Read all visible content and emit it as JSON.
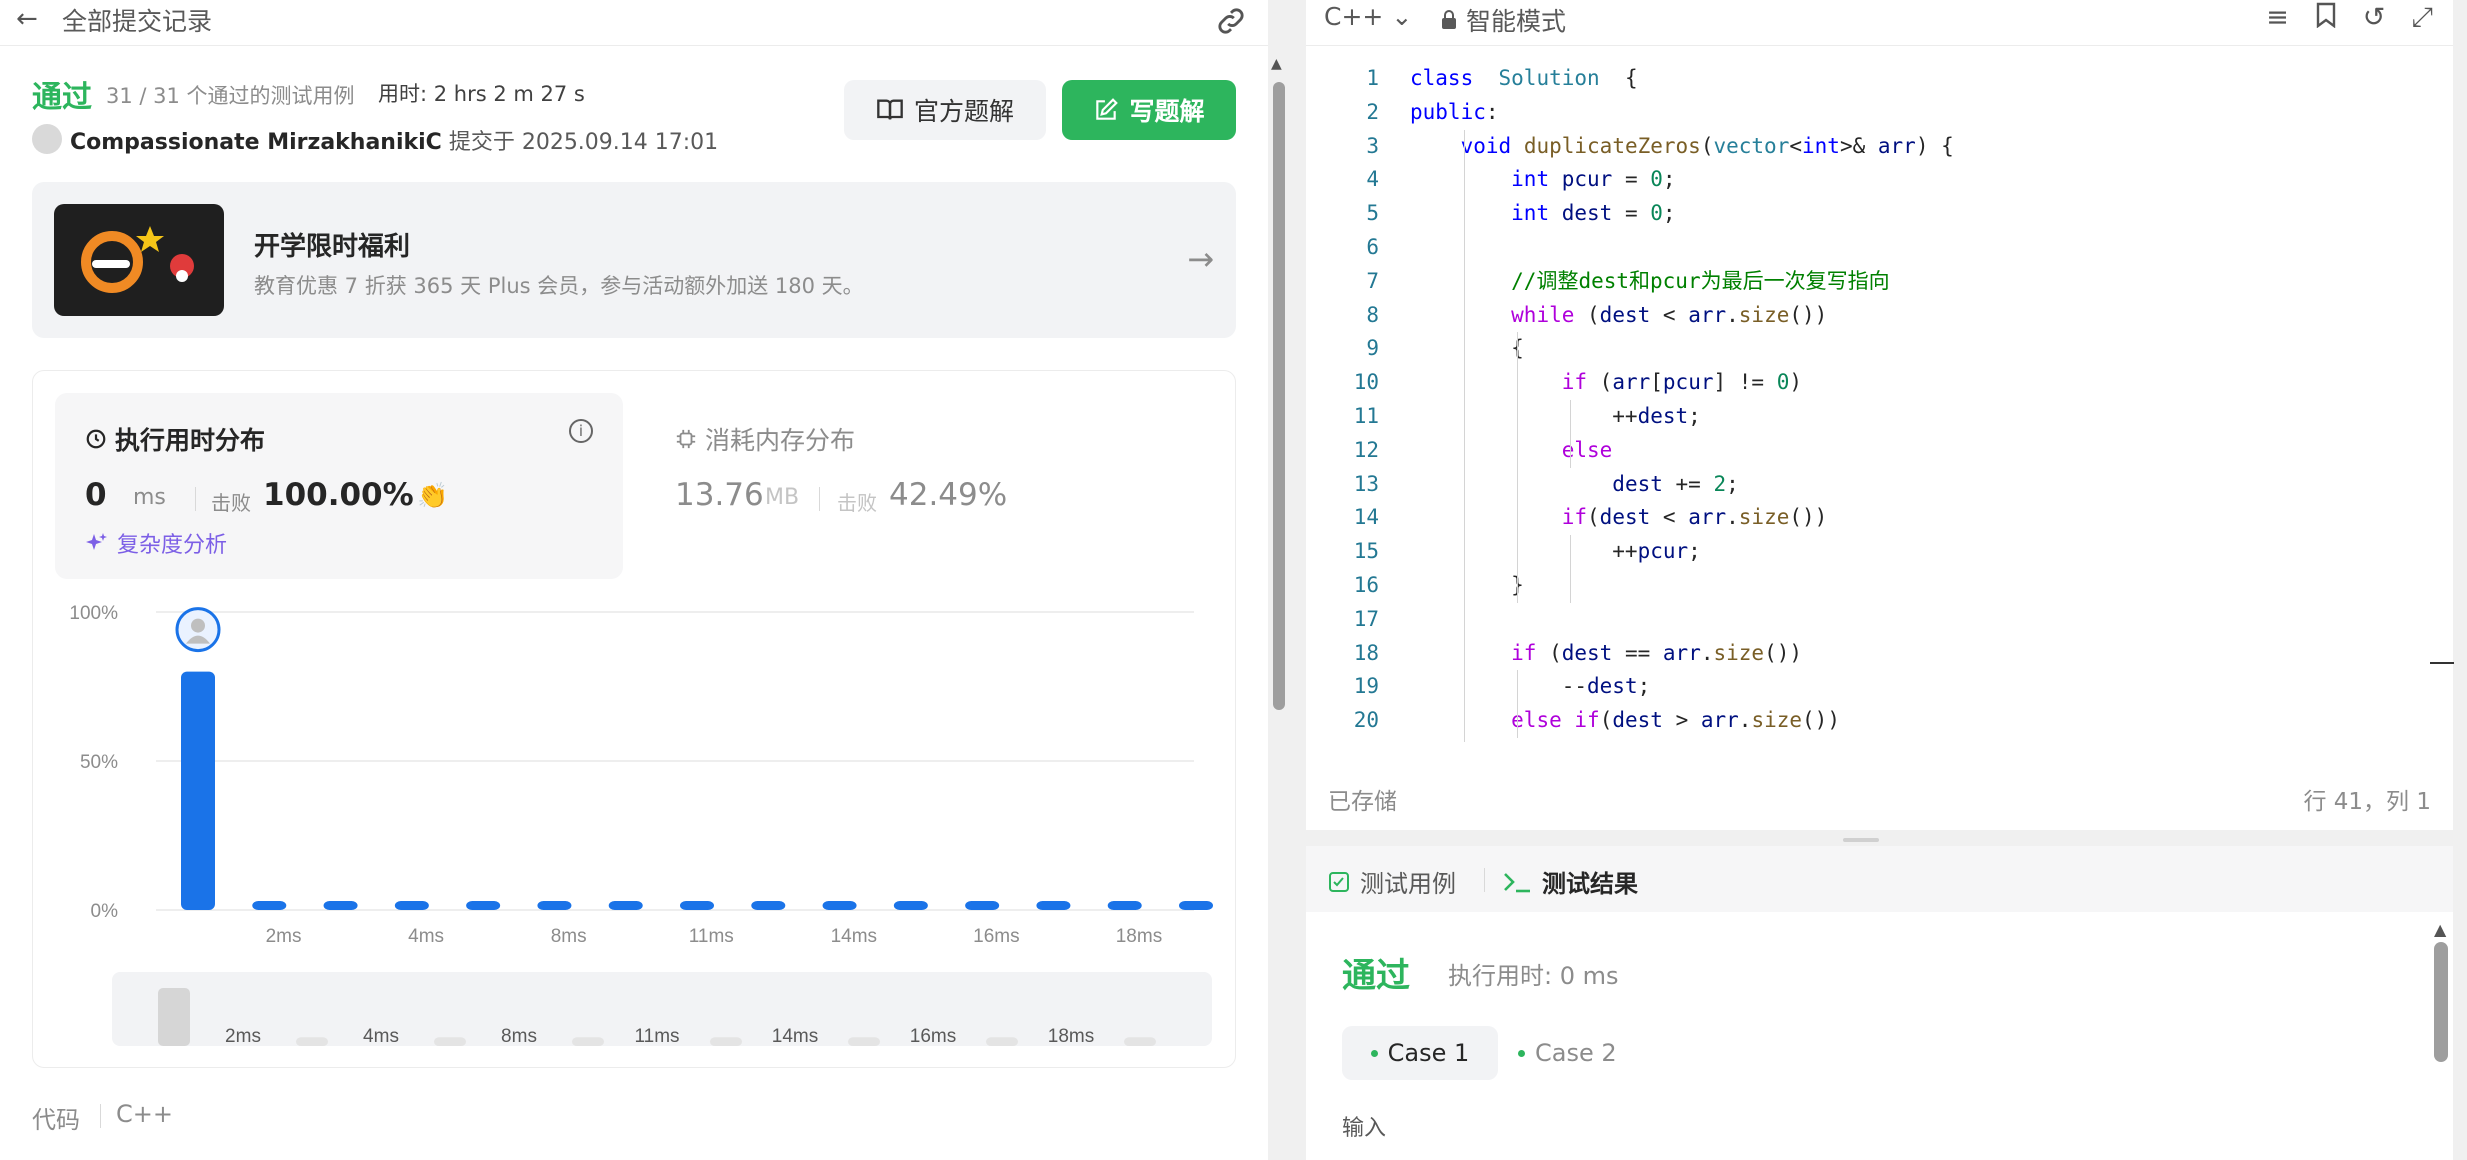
{
  "left": {
    "title": "全部提交记录",
    "status": "通过",
    "cases_passed": "31 / 31 个通过的测试用例",
    "elapsed": "用时: 2 hrs 2 m 27 s",
    "user": "Compassionate MirzakhanikiC",
    "submitted": "提交于 2025.09.14 17:01",
    "btn_official": "官方题解",
    "btn_write": "写题解",
    "promo_title": "开学限时福利",
    "promo_sub": "教育优惠 7 折获 365 天 Plus 会员，参与活动额外加送 180 天。",
    "runtime_head": "执行用时分布",
    "runtime_val": "0",
    "runtime_unit": "ms",
    "beat": "击败",
    "runtime_pct": "100.00%",
    "complexity": "复杂度分析",
    "mem_head": "消耗内存分布",
    "mem_val": "13.76",
    "mem_unit": "MB",
    "mem_pct": "42.49%",
    "code_label": "代码",
    "code_lang": "C++"
  },
  "chart_data": {
    "type": "bar",
    "ytick_labels": [
      "100%",
      "50%",
      "0%"
    ],
    "xtick_labels": [
      "2ms",
      "4ms",
      "8ms",
      "11ms",
      "14ms",
      "16ms",
      "18ms"
    ],
    "values": [
      80,
      3,
      3,
      3,
      3,
      3,
      3,
      3,
      3,
      3,
      3,
      3,
      3,
      3,
      3
    ],
    "ylim": [
      0,
      100
    ],
    "highlight_index": 0,
    "bar_color": "#1a73e8",
    "minimap_values": [
      20,
      3,
      3,
      3,
      3,
      3,
      3,
      3,
      3
    ]
  },
  "editor": {
    "lang": "C++",
    "mode": "智能模式",
    "saved": "已存储",
    "position": "行 41，列 1",
    "lines": [
      [
        [
          "k",
          "class"
        ],
        [
          "",
          "  "
        ],
        [
          "c",
          "Solution"
        ],
        [
          "",
          "  {"
        ]
      ],
      [
        [
          "k",
          "public"
        ],
        [
          "",
          ":"
        ]
      ],
      [
        [
          "",
          "    "
        ],
        [
          "k",
          "void"
        ],
        [
          "",
          " "
        ],
        [
          "f",
          "duplicateZeros"
        ],
        [
          "",
          "("
        ],
        [
          "c",
          "vector"
        ],
        [
          "",
          "<"
        ],
        [
          "k",
          "int"
        ],
        [
          "",
          ">& "
        ],
        [
          "p",
          "arr"
        ],
        [
          "",
          ") {"
        ]
      ],
      [
        [
          "",
          "        "
        ],
        [
          "k",
          "int"
        ],
        [
          "",
          " "
        ],
        [
          "p",
          "pcur"
        ],
        [
          "",
          " = "
        ],
        [
          "n",
          "0"
        ],
        [
          "",
          ";"
        ]
      ],
      [
        [
          "",
          "        "
        ],
        [
          "k",
          "int"
        ],
        [
          "",
          " "
        ],
        [
          "p",
          "dest"
        ],
        [
          "",
          " = "
        ],
        [
          "n",
          "0"
        ],
        [
          "",
          ";"
        ]
      ],
      [
        [
          "",
          ""
        ]
      ],
      [
        [
          "",
          "        "
        ],
        [
          "m",
          "//调整dest和pcur为最后一次复写指向"
        ]
      ],
      [
        [
          "",
          "        "
        ],
        [
          "ct",
          "while"
        ],
        [
          "",
          " ("
        ],
        [
          "p",
          "dest"
        ],
        [
          "",
          " < "
        ],
        [
          "p",
          "arr"
        ],
        [
          "",
          "."
        ],
        [
          "f",
          "size"
        ],
        [
          "",
          "())"
        ]
      ],
      [
        [
          "",
          "        {"
        ]
      ],
      [
        [
          "",
          "            "
        ],
        [
          "ct",
          "if"
        ],
        [
          "",
          " ("
        ],
        [
          "p",
          "arr"
        ],
        [
          "",
          "["
        ],
        [
          "p",
          "pcur"
        ],
        [
          "",
          "] != "
        ],
        [
          "n",
          "0"
        ],
        [
          "",
          ")"
        ]
      ],
      [
        [
          "",
          "                ++"
        ],
        [
          "p",
          "dest"
        ],
        [
          "",
          ";"
        ]
      ],
      [
        [
          "",
          "            "
        ],
        [
          "ct",
          "else"
        ]
      ],
      [
        [
          "",
          "                "
        ],
        [
          "p",
          "dest"
        ],
        [
          "",
          " += "
        ],
        [
          "n",
          "2"
        ],
        [
          "",
          ";"
        ]
      ],
      [
        [
          "",
          "            "
        ],
        [
          "ct",
          "if"
        ],
        [
          "",
          "("
        ],
        [
          "p",
          "dest"
        ],
        [
          "",
          " < "
        ],
        [
          "p",
          "arr"
        ],
        [
          "",
          "."
        ],
        [
          "f",
          "size"
        ],
        [
          "",
          "())"
        ]
      ],
      [
        [
          "",
          "                ++"
        ],
        [
          "p",
          "pcur"
        ],
        [
          "",
          ";"
        ]
      ],
      [
        [
          "",
          "        }"
        ]
      ],
      [
        [
          "",
          ""
        ]
      ],
      [
        [
          "",
          "        "
        ],
        [
          "ct",
          "if"
        ],
        [
          "",
          " ("
        ],
        [
          "p",
          "dest"
        ],
        [
          "",
          " == "
        ],
        [
          "p",
          "arr"
        ],
        [
          "",
          "."
        ],
        [
          "f",
          "size"
        ],
        [
          "",
          "())"
        ]
      ],
      [
        [
          "",
          "            --"
        ],
        [
          "p",
          "dest"
        ],
        [
          "",
          ";"
        ]
      ],
      [
        [
          "",
          "        "
        ],
        [
          "ct",
          "else"
        ],
        [
          "",
          " "
        ],
        [
          "ct",
          "if"
        ],
        [
          "",
          "("
        ],
        [
          "p",
          "dest"
        ],
        [
          "",
          " > "
        ],
        [
          "p",
          "arr"
        ],
        [
          "",
          "."
        ],
        [
          "f",
          "size"
        ],
        [
          "",
          "())"
        ]
      ],
      [
        [
          "",
          "        {"
        ]
      ]
    ]
  },
  "result": {
    "tab_cases": "测试用例",
    "tab_result": "测试结果",
    "status": "通过",
    "runtime": "执行用时: 0 ms",
    "case1": "Case 1",
    "case2": "Case 2",
    "input_label": "输入"
  }
}
